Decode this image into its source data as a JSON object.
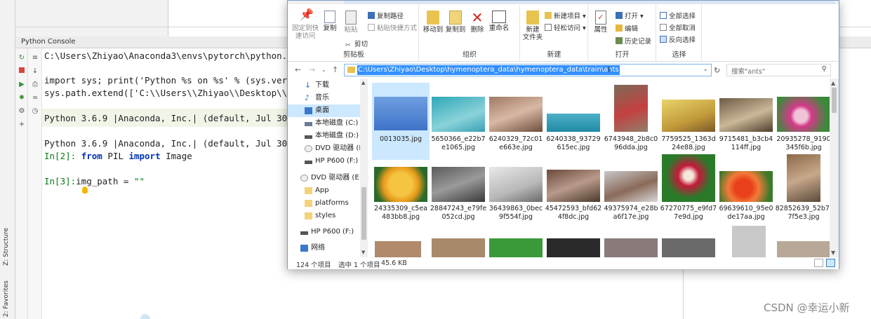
{
  "ide": {
    "console_tab": "Python Console",
    "side_tabs": [
      "2: Favorites",
      "Z: Structure"
    ],
    "lines": {
      "l1": "C:\\Users\\Zhiyao\\Anaconda3\\envs\\pytorch\\python.e",
      "l2": "import sys; print('Python %s on %s' % (sys.vers",
      "l3": "sys.path.extend(['C:\\\\Users\\\\Zhiyao\\\\Desktop\\\\l",
      "l4": "Python 3.6.9 |Anaconda, Inc.| (default, Jul 30",
      "l5": "Python 3.6.9 |Anaconda, Inc.| (default, Jul 30",
      "l6_prompt": "In[2]:",
      "l6_kw1": "from",
      "l6_mid": " PIL ",
      "l6_kw2": "import",
      "l6_end": " Image",
      "l7_prompt": "In[3]:",
      "l7_code": "img_path = ",
      "l7_str": "\"\""
    }
  },
  "ribbon": {
    "clipboard": {
      "pin": "固定到快\n速访问",
      "copy": "复制",
      "paste": "粘贴",
      "copy_path": "复制路径",
      "paste_shortcut": "粘贴快捷方式",
      "cut": "剪切",
      "label": "剪贴板"
    },
    "organize": {
      "move_to": "移动到",
      "copy_to": "复制到",
      "delete": "删除",
      "rename": "重命名",
      "label": "组织"
    },
    "new": {
      "new_folder": "新建\n文件夹",
      "new_item": "新建项目",
      "easy_access": "轻松访问",
      "label": "新建"
    },
    "open": {
      "properties": "属性",
      "open": "打开",
      "edit": "编辑",
      "history": "历史记录",
      "label": "打开"
    },
    "select": {
      "select_all": "全部选择",
      "select_none": "全部取消",
      "invert": "反向选择",
      "label": "选择"
    }
  },
  "address": {
    "path": "C:\\Users\\Zhiyao\\Desktop\\hymenoptera_data\\hymenoptera_data\\train\\ants",
    "search_placeholder": "搜索\"ants\""
  },
  "nav": {
    "items": [
      "下载",
      "音乐",
      "桌面",
      "本地磁盘 (C:)",
      "本地磁盘 (D:)",
      "DVD 驱动器 (E:)",
      "HP P600 (F:)",
      "DVD 驱动器 (E:) I",
      "App",
      "platforms",
      "styles",
      "HP P600 (F:)",
      "网络"
    ]
  },
  "files": [
    {
      "name": "0013035.jpg"
    },
    {
      "name": "5650366_e22b7e1065.jpg"
    },
    {
      "name": "6240329_72c01e663e.jpg"
    },
    {
      "name": "6240338_93729615ec.jpg"
    },
    {
      "name": "6743948_2b8c096dda.jpg"
    },
    {
      "name": "7759525_1363d24e88.jpg"
    },
    {
      "name": "9715481_b3cb4114ff.jpg"
    },
    {
      "name": "20935278_9190345f6b.jpg"
    },
    {
      "name": "24335309_c5ea483bb8.jpg"
    },
    {
      "name": "28847243_e79fe052cd.jpg"
    },
    {
      "name": "36439863_0bec9f554f.jpg"
    },
    {
      "name": "45472593_bfd624f8dc.jpg"
    },
    {
      "name": "49375974_e28ba6f17e.jpg"
    },
    {
      "name": "67270775_e9fd77e9d.jpg"
    },
    {
      "name": "69639610_95e0de17aa.jpg"
    },
    {
      "name": "82852639_52b7f7f5e3.jpg"
    }
  ],
  "status": {
    "count": "124 个项目",
    "selected": "选中 1 个项目",
    "size": "45.6 KB"
  },
  "watermark": "CSDN @幸运小新",
  "colors": {
    "selection": "#cce8ff",
    "path_highlight": "#3390ff",
    "keyword": "#0033b3",
    "string": "#067d17"
  }
}
